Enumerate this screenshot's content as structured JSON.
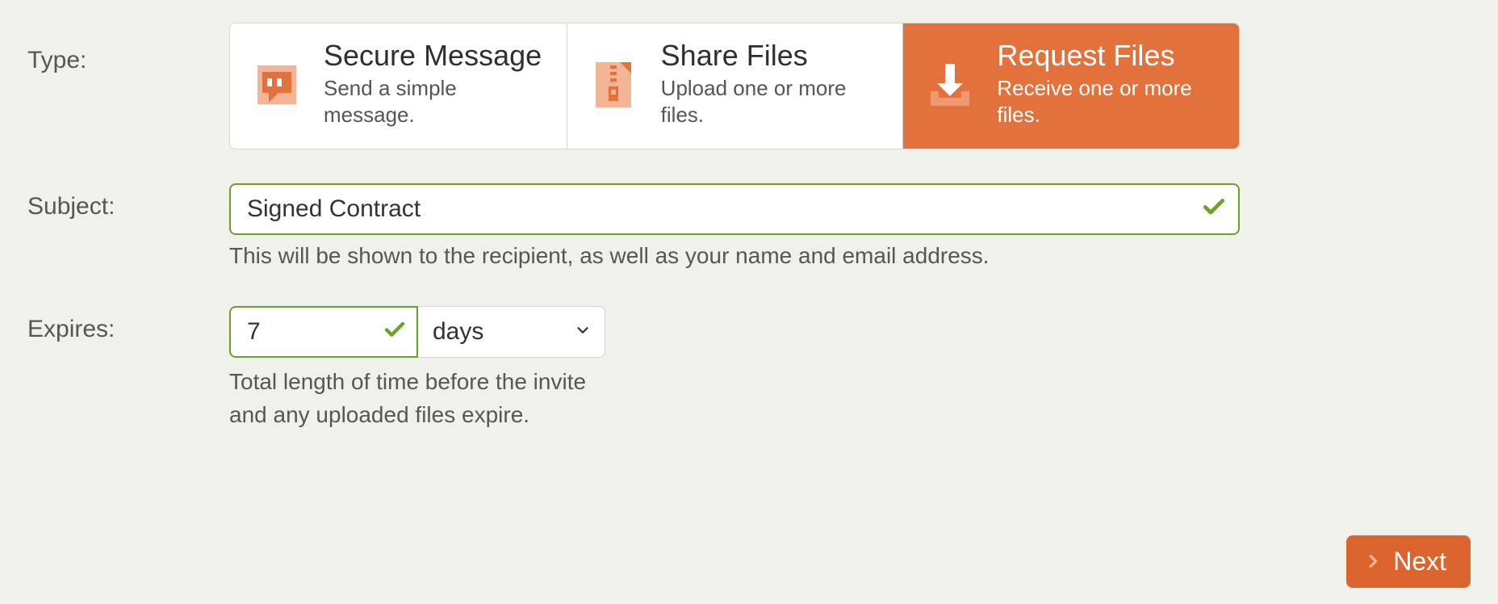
{
  "labels": {
    "type": "Type:",
    "subject": "Subject:",
    "expires": "Expires:"
  },
  "type_options": [
    {
      "key": "secure-message",
      "title": "Secure Message",
      "desc": "Send a simple message.",
      "selected": false
    },
    {
      "key": "share-files",
      "title": "Share Files",
      "desc": "Upload one or more files.",
      "selected": false
    },
    {
      "key": "request-files",
      "title": "Request Files",
      "desc": "Receive one or more files.",
      "selected": true
    }
  ],
  "subject": {
    "value": "Signed Contract",
    "hint": "This will be shown to the recipient, as well as your name and email address.",
    "valid": true
  },
  "expires": {
    "value": "7",
    "unit": "days",
    "hint": "Total length of time before the invite and any uploaded files expire.",
    "valid": true
  },
  "buttons": {
    "next": "Next"
  },
  "colors": {
    "accent": "#e3713b",
    "valid": "#6aa322"
  }
}
